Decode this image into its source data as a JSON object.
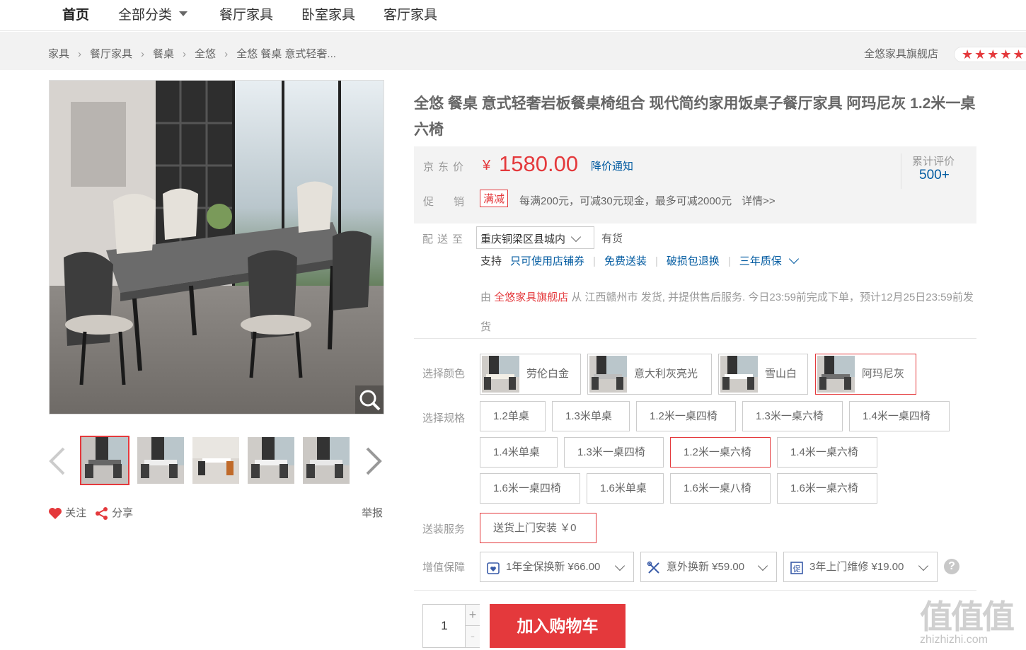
{
  "nav": {
    "items": [
      "首页",
      "全部分类",
      "餐厅家具",
      "卧室家具",
      "客厅家具"
    ]
  },
  "breadcrumb": {
    "items": [
      "家具",
      "餐厅家具",
      "餐桌",
      "全悠",
      "全悠 餐桌 意式轻奢..."
    ]
  },
  "shop": {
    "name": "全悠家具旗舰店",
    "rating_stars": "★★★★★"
  },
  "product": {
    "title": "全悠 餐桌 意式轻奢岩板餐桌椅组合 现代简约家用饭桌子餐厅家具 阿玛尼灰 1.2米一桌六椅",
    "price_label": "京东价",
    "price_symbol": "¥",
    "price": "1580.00",
    "price_notify": "降价通知",
    "reviews_label": "累计评价",
    "reviews_count": "500+",
    "promo_label": "促销",
    "promo_tag": "满减",
    "promo_text": "每满200元，可减30元现金，最多可减2000元",
    "promo_more": "详情>>"
  },
  "delivery": {
    "label": "配送至",
    "location": "重庆铜梁区县城内",
    "stock": "有货",
    "support_label": "支持",
    "services": [
      "只可使用店铺券",
      "免费送装",
      "破损包退换",
      "三年质保"
    ],
    "from_prefix": "由",
    "store": "全悠家具旗舰店",
    "from_text": "从 江西赣州市 发货, 并提供售后服务. 今日23:59前完成下单，预计12月25日23:59前发货"
  },
  "color": {
    "label": "选择颜色",
    "options": [
      "劳伦白金",
      "意大利灰亮光",
      "雪山白",
      "阿玛尼灰"
    ],
    "selected": "阿玛尼灰"
  },
  "spec": {
    "label": "选择规格",
    "options": [
      "1.2单桌",
      "1.3米单桌",
      "1.2米一桌四椅",
      "1.3米一桌六椅",
      "1.4米一桌四椅",
      "1.4米单桌",
      "1.3米一桌四椅",
      "1.2米一桌六椅",
      "1.4米一桌六椅",
      "1.6米一桌四椅",
      "1.6米单桌",
      "1.6米一桌八椅",
      "1.6米一桌六椅"
    ],
    "selected": "1.2米一桌六椅"
  },
  "install": {
    "label": "送装服务",
    "option": "送货上门安装 ￥0"
  },
  "vas": {
    "label": "增值保障",
    "options": [
      "1年全保换新 ¥66.00",
      "意外换新 ¥59.00",
      "3年上门维修 ¥19.00"
    ],
    "help": "?"
  },
  "cart": {
    "quantity": "1",
    "plus": "+",
    "minus": "-",
    "button": "加入购物车"
  },
  "actions": {
    "follow": "关注",
    "share": "分享",
    "report": "举报"
  },
  "watermark": {
    "cn": "值值值",
    "en": "zhizhizhi.com"
  }
}
